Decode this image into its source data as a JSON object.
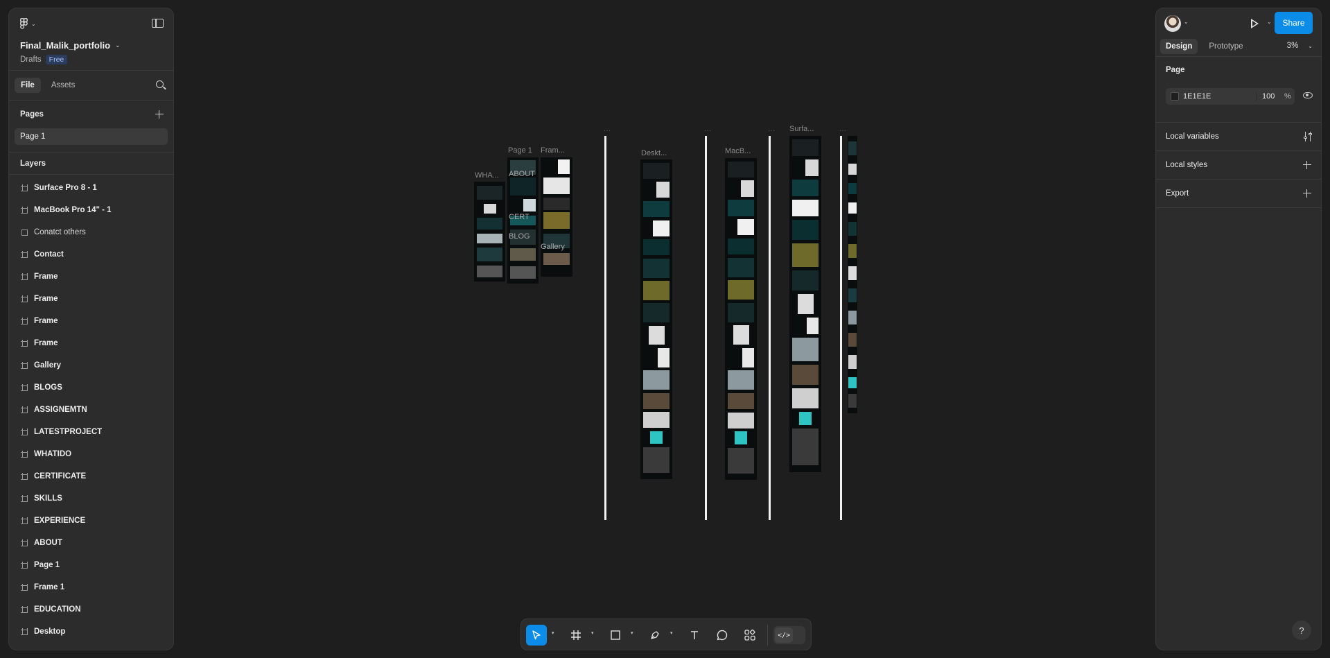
{
  "file": {
    "name": "Final_Malik_portfolio",
    "location": "Drafts",
    "plan": "Free"
  },
  "left_tabs": {
    "file": "File",
    "assets": "Assets"
  },
  "pages": {
    "title": "Pages",
    "items": [
      "Page 1"
    ]
  },
  "layers": {
    "title": "Layers",
    "items": [
      {
        "label": "Surface Pro 8 - 1",
        "icon": "frame-icon",
        "bold": true
      },
      {
        "label": "MacBook Pro 14\" - 1",
        "icon": "frame-icon",
        "bold": true
      },
      {
        "label": "Conatct others",
        "icon": "rectangle-icon",
        "bold": false
      },
      {
        "label": "Contact",
        "icon": "frame-icon",
        "bold": true
      },
      {
        "label": "Frame",
        "icon": "frame-icon",
        "bold": true
      },
      {
        "label": "Frame",
        "icon": "frame-icon",
        "bold": true
      },
      {
        "label": "Frame",
        "icon": "frame-icon",
        "bold": true
      },
      {
        "label": "Frame",
        "icon": "frame-icon",
        "bold": true
      },
      {
        "label": "Gallery",
        "icon": "frame-icon",
        "bold": true
      },
      {
        "label": "BLOGS",
        "icon": "frame-icon",
        "bold": true
      },
      {
        "label": "ASSIGNEMTN",
        "icon": "frame-icon",
        "bold": true
      },
      {
        "label": "LATESTPROJECT",
        "icon": "frame-icon",
        "bold": true
      },
      {
        "label": "WHATIDO",
        "icon": "frame-icon",
        "bold": true
      },
      {
        "label": "CERTIFICATE",
        "icon": "frame-icon",
        "bold": true
      },
      {
        "label": "SKILLS",
        "icon": "frame-icon",
        "bold": true
      },
      {
        "label": "EXPERIENCE",
        "icon": "frame-icon",
        "bold": true
      },
      {
        "label": "ABOUT",
        "icon": "frame-icon",
        "bold": true
      },
      {
        "label": "Page 1",
        "icon": "frame-icon",
        "bold": true
      },
      {
        "label": "Frame 1",
        "icon": "frame-icon",
        "bold": true
      },
      {
        "label": "EDUCATION",
        "icon": "frame-icon",
        "bold": true
      },
      {
        "label": "Desktop",
        "icon": "frame-icon",
        "bold": true
      }
    ]
  },
  "canvas": {
    "frame_labels": [
      "WHA...",
      "Page 1",
      "Fram...",
      "Deskt...",
      "MacB...",
      "Surfa..."
    ],
    "inner_labels": [
      "ABOUT",
      "CERT",
      "BLOG",
      "Gallery"
    ],
    "handle_dots": "···"
  },
  "right_panel": {
    "share_label": "Share",
    "tabs": {
      "design": "Design",
      "prototype": "Prototype"
    },
    "zoom": "3%",
    "page_section": {
      "title": "Page",
      "background_hex": "1E1E1E",
      "opacity": "100",
      "opacity_unit": "%"
    },
    "local_variables": "Local variables",
    "local_styles": "Local styles",
    "export": "Export",
    "help": "?"
  },
  "toolbar": {
    "tools": [
      "move-tool",
      "frame-tool",
      "shape-tool",
      "pen-tool",
      "text-tool",
      "comment-tool",
      "actions-tool"
    ],
    "dev_mode_glyph": "</>"
  },
  "colors": {
    "accent": "#0c8ce9",
    "canvas_bg": "#1e1e1e",
    "panel_bg": "#2c2c2c",
    "teal": "#2ec4c4"
  }
}
